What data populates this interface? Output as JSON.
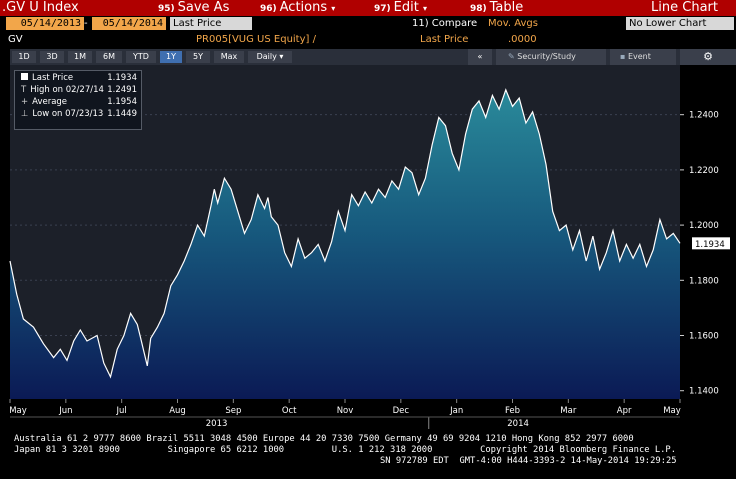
{
  "header": {
    "ticker": ".GV U Index",
    "buttons": [
      {
        "num": "95)",
        "label": "Save As"
      },
      {
        "num": "96)",
        "label": "Actions"
      },
      {
        "num": "97)",
        "label": "Edit"
      },
      {
        "num": "98)",
        "label": "Table"
      }
    ],
    "title": "Line Chart"
  },
  "controls": {
    "start_date": "05/14/2013",
    "end_date": "05/14/2014",
    "dash": "-",
    "field": "Last Price",
    "compare": "11) Compare",
    "mov_avgs": "Mov. Avgs",
    "lower_chart": "No Lower Chart",
    "security_code": "GV",
    "security_ref": "PR005[VUG US Equity] /",
    "field_label": "Last Price",
    "field_value": ".0000"
  },
  "toolbar": {
    "ranges": [
      "1D",
      "3D",
      "1M",
      "6M",
      "YTD",
      "1Y",
      "5Y",
      "Max"
    ],
    "active_range": "1Y",
    "frequency": "Daily ▾",
    "collapse": "«",
    "security_study": "Security/Study",
    "event": "Event",
    "settings_icon": "gear-icon"
  },
  "legend": {
    "last_price_label": "Last Price",
    "last_price_value": "1.1934",
    "high_label": "High on 02/27/14",
    "high_value": "1.2491",
    "avg_label": "Average",
    "avg_value": "1.1954",
    "low_label": "Low on 07/23/13",
    "low_value": "1.1449"
  },
  "footer": {
    "line1": "Australia 61 2 9777 8600 Brazil 5511 3048 4500 Europe 44 20 7330 7500 Germany 49 69 9204 1210 Hong Kong 852 2977 6000",
    "line2": "Japan 81 3 3201 8900         Singapore 65 6212 1000         U.S. 1 212 318 2000         Copyright 2014 Bloomberg Finance L.P.",
    "line3": "SN 972789 EDT  GMT-4:00 H444-3393-2 14-May-2014 19:29:25"
  },
  "colors": {
    "bar_red": "#b00000",
    "accent_orange": "#f2a64a",
    "area_top": "#2a8a9a",
    "area_bottom": "#0b1a55"
  },
  "chart_data": {
    "type": "area",
    "y_ticks": [
      1.14,
      1.16,
      1.18,
      1.2,
      1.22,
      1.24
    ],
    "y_tick_labels": [
      "1.1400",
      "1.1600",
      "1.1800",
      "1.2000",
      "1.2200",
      "1.2400"
    ],
    "ylim": [
      1.137,
      1.258
    ],
    "x_month_labels": [
      "May",
      "Jun",
      "Jul",
      "Aug",
      "Sep",
      "Oct",
      "Nov",
      "Dec",
      "Jan",
      "Feb",
      "Mar",
      "Apr",
      "May"
    ],
    "year_labels": [
      "2013",
      "2014"
    ],
    "last_value_label": "1.1934",
    "x": [
      0,
      0.01,
      0.02,
      0.035,
      0.05,
      0.065,
      0.075,
      0.085,
      0.095,
      0.105,
      0.115,
      0.13,
      0.14,
      0.15,
      0.16,
      0.17,
      0.18,
      0.19,
      0.195,
      0.2,
      0.205,
      0.21,
      0.22,
      0.23,
      0.24,
      0.25,
      0.26,
      0.27,
      0.28,
      0.29,
      0.3,
      0.305,
      0.31,
      0.32,
      0.33,
      0.34,
      0.35,
      0.36,
      0.37,
      0.38,
      0.385,
      0.39,
      0.4,
      0.41,
      0.42,
      0.43,
      0.44,
      0.45,
      0.46,
      0.47,
      0.48,
      0.49,
      0.5,
      0.51,
      0.52,
      0.53,
      0.54,
      0.55,
      0.56,
      0.57,
      0.58,
      0.59,
      0.6,
      0.61,
      0.62,
      0.63,
      0.64,
      0.65,
      0.66,
      0.67,
      0.68,
      0.69,
      0.7,
      0.71,
      0.72,
      0.73,
      0.74,
      0.75,
      0.76,
      0.77,
      0.78,
      0.79,
      0.8,
      0.81,
      0.82,
      0.83,
      0.84,
      0.85,
      0.86,
      0.87,
      0.88,
      0.89,
      0.9,
      0.91,
      0.92,
      0.93,
      0.94,
      0.95,
      0.96,
      0.97,
      0.98,
      0.99,
      1.0
    ],
    "y": [
      1.187,
      1.175,
      1.166,
      1.163,
      1.157,
      1.152,
      1.155,
      1.151,
      1.158,
      1.162,
      1.158,
      1.16,
      1.15,
      1.145,
      1.155,
      1.16,
      1.168,
      1.164,
      1.159,
      1.154,
      1.149,
      1.159,
      1.163,
      1.168,
      1.178,
      1.182,
      1.187,
      1.193,
      1.2,
      1.196,
      1.207,
      1.213,
      1.208,
      1.217,
      1.213,
      1.205,
      1.197,
      1.202,
      1.211,
      1.206,
      1.21,
      1.203,
      1.2,
      1.19,
      1.185,
      1.195,
      1.188,
      1.19,
      1.193,
      1.187,
      1.194,
      1.205,
      1.198,
      1.211,
      1.207,
      1.212,
      1.208,
      1.213,
      1.21,
      1.216,
      1.213,
      1.221,
      1.219,
      1.211,
      1.217,
      1.229,
      1.239,
      1.236,
      1.226,
      1.22,
      1.233,
      1.242,
      1.245,
      1.239,
      1.247,
      1.242,
      1.249,
      1.243,
      1.246,
      1.237,
      1.241,
      1.233,
      1.222,
      1.205,
      1.198,
      1.2,
      1.191,
      1.198,
      1.187,
      1.196,
      1.184,
      1.19,
      1.198,
      1.187,
      1.193,
      1.188,
      1.193,
      1.185,
      1.191,
      1.202,
      1.195,
      1.197,
      1.1934
    ]
  }
}
